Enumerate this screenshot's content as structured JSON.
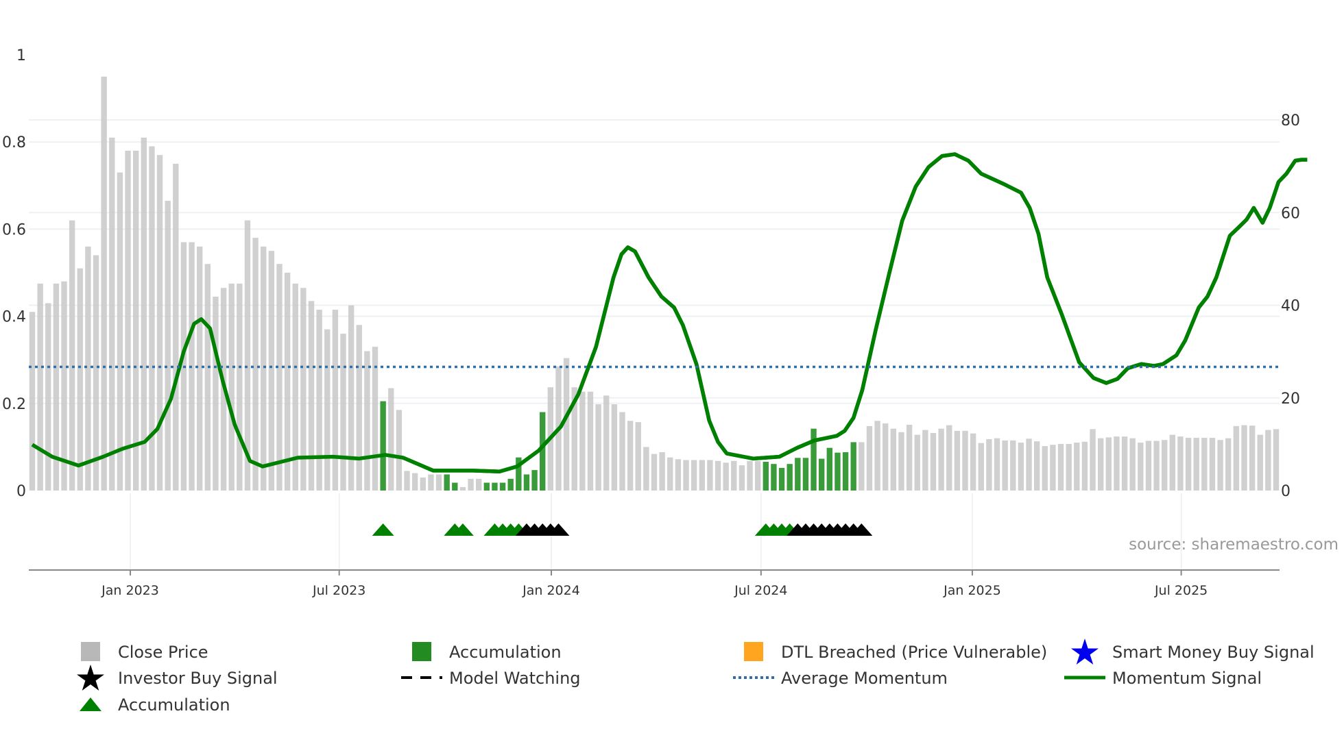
{
  "chart_data": {
    "type": "bar",
    "title": "",
    "xlabel": "",
    "ylabel": "",
    "ylim_left": [
      0,
      1
    ],
    "ylim_right": [
      0,
      94
    ],
    "left_ticks": [
      "0",
      "0.2",
      "0.4",
      "0.6",
      "0.8",
      "1"
    ],
    "left_tick_values": [
      0,
      0.2,
      0.4,
      0.6,
      0.8,
      1
    ],
    "right_ticks": [
      "0",
      "20",
      "40",
      "60",
      "80"
    ],
    "right_tick_values": [
      0,
      20,
      40,
      60,
      80
    ],
    "x_ticks": [
      "Jan 2023",
      "Jul 2023",
      "Jan 2024",
      "Jul 2024",
      "Jan 2025",
      "Jul 2025"
    ],
    "x_tick_week_index": [
      12.3,
      38.5,
      65.1,
      91.4,
      117.9,
      144.1
    ],
    "grid": true,
    "legend_position": "bottom",
    "close_price_weekly": [
      0.41,
      0.475,
      0.43,
      0.475,
      0.48,
      0.62,
      0.51,
      0.56,
      0.54,
      0.95,
      0.81,
      0.73,
      0.78,
      0.78,
      0.81,
      0.79,
      0.77,
      0.665,
      0.75,
      0.57,
      0.57,
      0.56,
      0.52,
      0.445,
      0.465,
      0.475,
      0.475,
      0.62,
      0.58,
      0.56,
      0.55,
      0.52,
      0.5,
      0.475,
      0.465,
      0.435,
      0.415,
      0.37,
      0.415,
      0.36,
      0.425,
      0.38,
      0.32,
      0.33,
      0.205,
      0.235,
      0.185,
      0.045,
      0.04,
      0.03,
      0.037,
      0.037,
      0.037,
      0.018,
      0.008,
      0.027,
      0.027,
      0.018,
      0.018,
      0.018,
      0.027,
      0.076,
      0.037,
      0.047,
      0.18,
      0.237,
      0.285,
      0.304,
      0.237,
      0.227,
      0.227,
      0.198,
      0.218,
      0.198,
      0.18,
      0.16,
      0.157,
      0.1,
      0.084,
      0.088,
      0.076,
      0.072,
      0.07,
      0.07,
      0.07,
      0.07,
      0.068,
      0.064,
      0.068,
      0.058,
      0.068,
      0.068,
      0.066,
      0.061,
      0.052,
      0.061,
      0.075,
      0.075,
      0.142,
      0.073,
      0.098,
      0.087,
      0.088,
      0.111,
      0.111,
      0.148,
      0.16,
      0.154,
      0.142,
      0.134,
      0.151,
      0.128,
      0.139,
      0.132,
      0.142,
      0.15,
      0.137,
      0.137,
      0.131,
      0.109,
      0.118,
      0.12,
      0.115,
      0.115,
      0.11,
      0.119,
      0.113,
      0.102,
      0.105,
      0.107,
      0.107,
      0.11,
      0.112,
      0.141,
      0.12,
      0.122,
      0.124,
      0.124,
      0.12,
      0.11,
      0.114,
      0.114,
      0.116,
      0.128,
      0.124,
      0.121,
      0.121,
      0.121,
      0.121,
      0.116,
      0.12,
      0.148,
      0.15,
      0.149,
      0.128,
      0.139,
      0.141
    ],
    "accumulation_bar_indices": [
      44,
      52,
      53,
      57,
      58,
      59,
      60,
      61,
      62,
      63,
      64,
      92,
      93,
      94,
      95,
      96,
      97,
      98,
      99,
      100,
      101,
      102,
      103
    ],
    "accumulation_marker_indices": [
      44,
      53,
      54,
      58,
      59,
      60,
      61,
      92,
      93,
      94,
      95
    ],
    "investor_buy_marker_indices": [
      62,
      63,
      64,
      65,
      66,
      96,
      97,
      98,
      99,
      100,
      101,
      102,
      103,
      104
    ],
    "average_momentum": 26.7,
    "momentum_signal": {
      "week_index": [
        0,
        2.5,
        5.8,
        8.9,
        11.3,
        14.1,
        15.7,
        17.4,
        19,
        20.3,
        21.2,
        22.3,
        23.9,
        25.4,
        27.3,
        28.9,
        33.3,
        37.7,
        41,
        44.3,
        46.5,
        50.3,
        55.3,
        58.6,
        60.8,
        63.5,
        66.3,
        68.5,
        70.7,
        72.9,
        73.9,
        74.7,
        75.6,
        77.3,
        78.9,
        80.5,
        81.6,
        83.3,
        84.9,
        86,
        87.1,
        90.4,
        93.7,
        95.9,
        98.1,
        100.9,
        101.9,
        103,
        104.1,
        105.8,
        107.5,
        109.1,
        110.8,
        112.4,
        114.1,
        115.7,
        117.4,
        119,
        121.8,
        124,
        125.1,
        126.2,
        127.3,
        129.1,
        130.2,
        131.3,
        133.1,
        134.7,
        136.1,
        137.4,
        139.1,
        140.7,
        141.8,
        143.5,
        144.6,
        146.3,
        147.4,
        148.5,
        150.2,
        151.3,
        152.3,
        153.2,
        154.3,
        155.2,
        156.3,
        157.3,
        158.4,
        159.2,
        159.9
      ],
      "values": [
        9.9,
        7.3,
        5.4,
        7.3,
        9,
        10.5,
        13.3,
        19.8,
        30,
        36,
        37,
        35,
        23.6,
        14.2,
        6.4,
        5.2,
        7.1,
        7.3,
        6.9,
        7.7,
        7.1,
        4.3,
        4.3,
        4.1,
        5.2,
        8.6,
        13.8,
        20.8,
        31,
        46,
        51,
        52.5,
        51.6,
        46,
        41.9,
        39.5,
        35.7,
        27.3,
        15.1,
        10.5,
        8,
        6.9,
        7.3,
        9.2,
        10.8,
        11.8,
        12.9,
        15.7,
        21.7,
        34.8,
        47,
        58.2,
        65.6,
        69.8,
        72.2,
        72.6,
        71.2,
        68.4,
        66.2,
        64.3,
        61,
        55.4,
        46,
        38.1,
        32.9,
        27.7,
        24.3,
        23.2,
        24.1,
        26.4,
        27.3,
        26.9,
        27.3,
        29.2,
        32.4,
        39.5,
        41.9,
        46,
        55,
        56.8,
        58.5,
        61,
        57.8,
        61,
        66.6,
        68.4,
        71.2,
        71.4,
        71.4
      ]
    },
    "legend": [
      {
        "label": "Close Price",
        "color": "#b8b8b8",
        "icon": "square"
      },
      {
        "label": "Accumulation",
        "color": "#228b22",
        "icon": "square"
      },
      {
        "label": "DTL Breached (Price Vulnerable)",
        "color": "#ffa520",
        "icon": "square"
      },
      {
        "label": "Smart Money Buy Signal",
        "color": "#0000ee",
        "icon": "star"
      },
      {
        "label": "Investor Buy Signal",
        "color": "#000000",
        "icon": "star"
      },
      {
        "label": "Model Watching",
        "color": "#000000",
        "icon": "dashed-line"
      },
      {
        "label": "Average Momentum",
        "color": "#2e6fa7",
        "icon": "dotted-line"
      },
      {
        "label": "Momentum Signal",
        "color": "#008000",
        "icon": "line"
      },
      {
        "label": "Accumulation",
        "color": "#008000",
        "icon": "triangle"
      }
    ],
    "source": "source: sharemaestro.com"
  }
}
